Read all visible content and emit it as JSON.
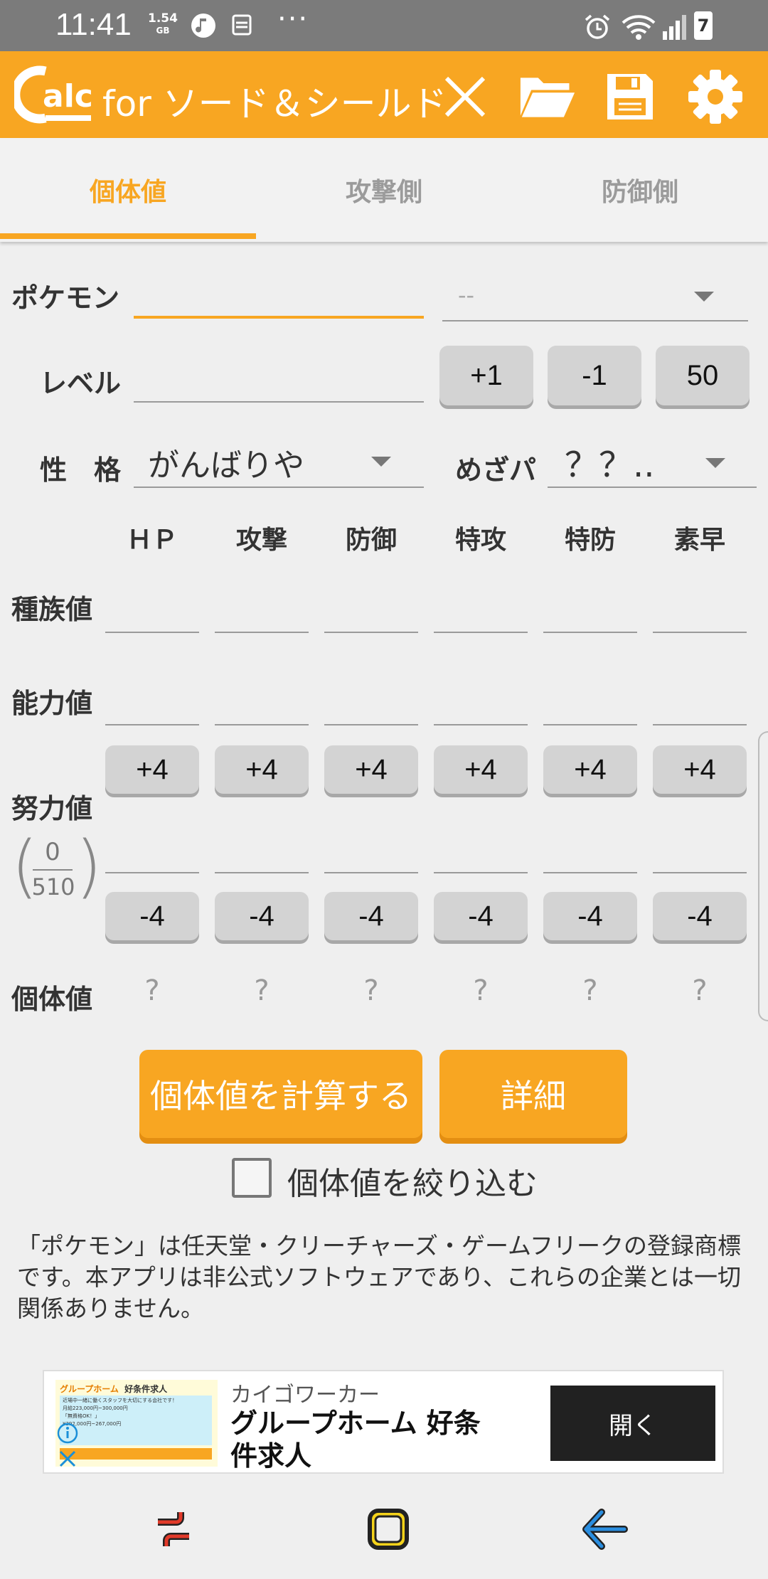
{
  "status_bar": {
    "time": "11:41",
    "data_speed_value": "1.54",
    "data_speed_unit": "GB",
    "more": "···",
    "battery": "7"
  },
  "app_bar": {
    "logo": "alc",
    "title": "for ソード＆シールド",
    "icons": [
      "close-icon",
      "folder-icon",
      "save-icon",
      "gear-icon"
    ]
  },
  "tabs": [
    {
      "label": "個体値",
      "active": true
    },
    {
      "label": "攻撃側",
      "active": false
    },
    {
      "label": "防御側",
      "active": false
    }
  ],
  "form": {
    "pokemon_label": "ポケモン",
    "pokemon_value": "",
    "form_select_value": "--",
    "level_label": "レベル",
    "level_value": "",
    "level_buttons": [
      "+1",
      "-1",
      "50"
    ],
    "nature_label": "性　格",
    "nature_value": "がんばりや",
    "hidden_power_label": "めざパ",
    "hidden_power_value": "？？.."
  },
  "stats": {
    "columns": [
      "ＨＰ",
      "攻撃",
      "防御",
      "特攻",
      "特防",
      "素早"
    ],
    "base_label": "種族値",
    "actual_label": "能力値",
    "ev_label": "努力値",
    "ev_total": "0",
    "ev_max": "510",
    "ev_plus": "+4",
    "ev_minus": "-4",
    "iv_label": "個体値",
    "iv_values": [
      "?",
      "?",
      "?",
      "?",
      "?",
      "?"
    ]
  },
  "actions": {
    "calculate": "個体値を計算する",
    "details": "詳細",
    "narrow_down": "個体値を絞り込む",
    "narrow_down_checked": false
  },
  "disclaimer": "「ポケモン」は任天堂・クリーチャーズ・ゲームフリークの登録商標です。本アプリは非公式ソフトウェアであり、これらの企業とは一切関係ありません。",
  "ad": {
    "image_title": "グループホーム",
    "image_badge": "好条件求人",
    "image_lines": [
      "近場中一緒に働くスタッフを大切にする会社です！",
      "月給223,000円~300,000円",
      "「無資格OK！」",
      "¥392,000円~267,000円"
    ],
    "advertiser": "カイゴワーカー",
    "headline": "グループホーム 好条件求人",
    "cta": "開く"
  },
  "colors": {
    "accent": "#f8a622",
    "status_bar": "#7b7b7b",
    "button_gray": "#d3d3d3"
  }
}
